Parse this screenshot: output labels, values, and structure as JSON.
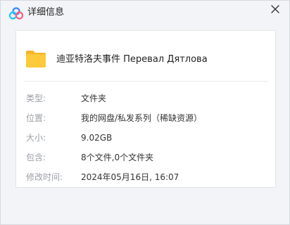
{
  "window": {
    "title": "详细信息",
    "close_icon": "close-icon",
    "app_icon": "baidu-netdisk-logo",
    "accent": "#3a85ff"
  },
  "file": {
    "icon": "folder-icon",
    "name": "迪亚特洛夫事件  Перевал Дятлова",
    "folder_color": "#ffc93c"
  },
  "details": [
    {
      "label": "类型:",
      "value": "文件夹"
    },
    {
      "label": "位置:",
      "value": "我的网盘/私发系列（稀缺资源）"
    },
    {
      "label": "大小:",
      "value": "9.02GB"
    },
    {
      "label": "包含:",
      "value": "8个文件,0个文件夹"
    },
    {
      "label": "修改时间:",
      "value": "2024年05月16日, 16:07"
    }
  ]
}
